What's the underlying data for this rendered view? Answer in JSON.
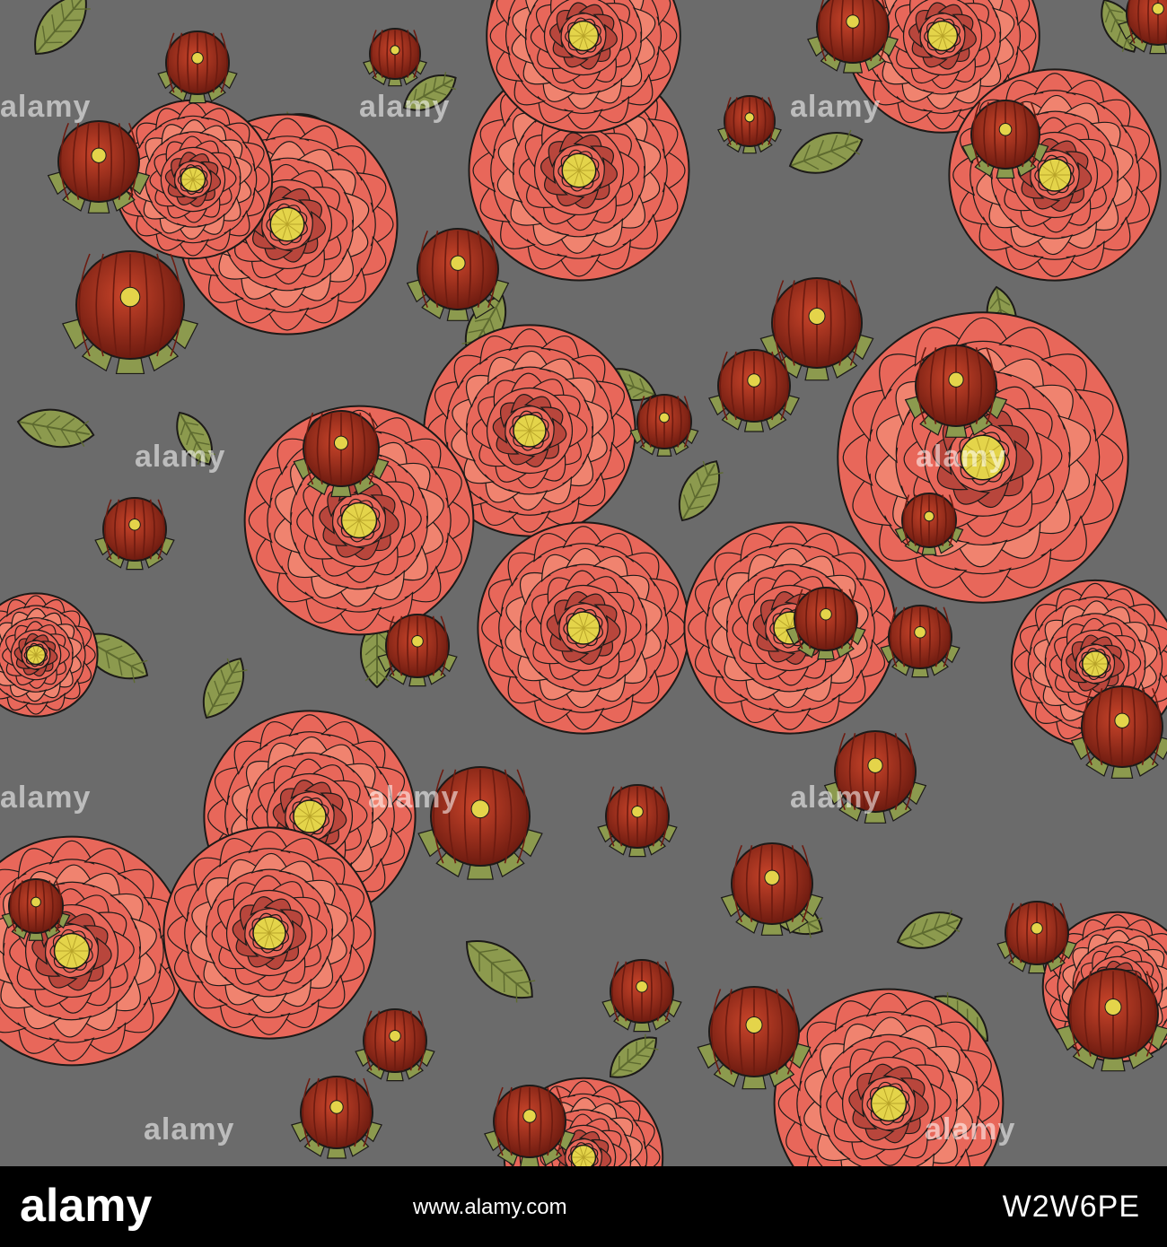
{
  "image": {
    "subject": "seamless floral pattern",
    "background_color": "#6b6b6b",
    "colors": {
      "petal": "#e8675a",
      "petal_light": "#f0836f",
      "petal_dark": "#b8463c",
      "bud": "#a8321f",
      "bud_dark": "#6d1b10",
      "center": "#e4d44a",
      "leaf": "#8c9a4e",
      "leaf_dark": "#5d6a2f",
      "outline": "#1c1a18"
    }
  },
  "watermark": {
    "text": "alamy"
  },
  "footer": {
    "logo_text": "alamy",
    "url": "www.alamy.com",
    "image_id": "W2W6PE"
  }
}
